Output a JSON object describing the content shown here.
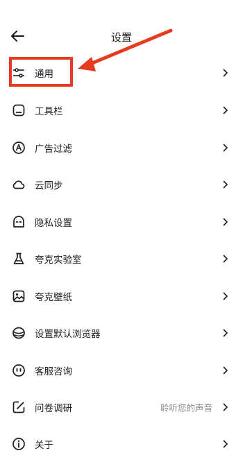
{
  "header": {
    "title": "设置",
    "back_icon": "back-arrow-icon"
  },
  "settings": {
    "items": [
      {
        "label": "通用",
        "icon": "sliders-icon"
      },
      {
        "label": "工具栏",
        "icon": "toolbar-icon"
      },
      {
        "label": "广告过滤",
        "icon": "ad-filter-icon"
      },
      {
        "label": "云同步",
        "icon": "cloud-icon"
      },
      {
        "label": "隐私设置",
        "icon": "privacy-icon"
      },
      {
        "label": "夸克实验室",
        "icon": "flask-icon"
      },
      {
        "label": "夸克壁纸",
        "icon": "wallpaper-icon"
      },
      {
        "label": "设置默认浏览器",
        "icon": "browser-icon"
      },
      {
        "label": "客服咨询",
        "icon": "support-icon"
      },
      {
        "label": "问卷调研",
        "icon": "survey-icon",
        "value": "聆听您的声音"
      },
      {
        "label": "关于",
        "icon": "info-icon"
      }
    ]
  },
  "annotation": {
    "color": "#e63b1f"
  }
}
